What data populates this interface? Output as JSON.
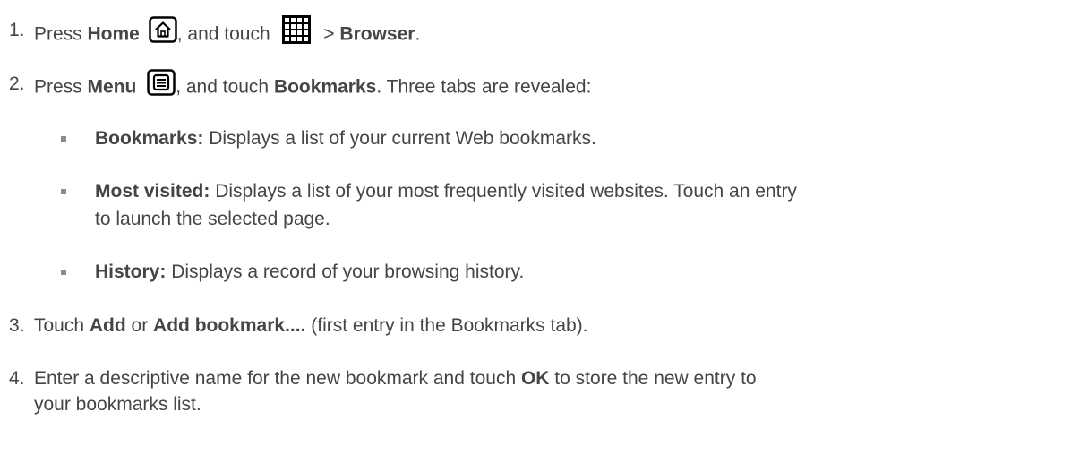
{
  "steps": [
    {
      "num": "1.",
      "a": "Press ",
      "b": "Home",
      "c": ", and touch ",
      "d": " > ",
      "e": "Browser",
      "f": "."
    },
    {
      "num": "2.",
      "a": "Press ",
      "b": "Menu",
      "c": ", and touch ",
      "d": "Bookmarks",
      "e": ". Three tabs are revealed:"
    },
    {
      "num": "3.",
      "a": "Touch ",
      "b": "Add",
      "c": " or ",
      "d": "Add bookmark....",
      "e": " (first entry in the Bookmarks tab)."
    },
    {
      "num": "4.",
      "line1a": "Enter a descriptive name for the new bookmark and touch ",
      "line1b": "OK",
      "line1c": " to store the new entry to",
      "line2": "your bookmarks list."
    }
  ],
  "bullets": [
    {
      "label": "Bookmarks:",
      "text": " Displays a list of your current Web bookmarks."
    },
    {
      "label": "Most visited:",
      "text": " Displays a list of your most frequently visited websites. Touch an entry",
      "text2": "to launch the selected page."
    },
    {
      "label": "History:",
      "text": " Displays a record of your browsing history."
    }
  ],
  "icons": {
    "home": "home-icon",
    "apps": "apps-grid-icon",
    "menu": "menu-icon"
  }
}
